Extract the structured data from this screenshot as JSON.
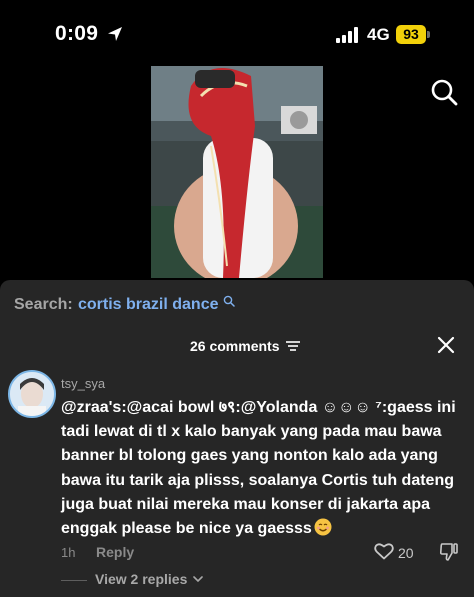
{
  "status_bar": {
    "time": "0:09",
    "network": "4G",
    "battery": "93"
  },
  "search": {
    "prefix": "Search:",
    "query": "cortis brazil dance"
  },
  "comments": {
    "count_label": "26 comments",
    "items": [
      {
        "username": "tsy_sya",
        "text": "@zraa's:@acai bowl ७९:@Yolanda ☺☺☺ ⁷:gaess ini tadi lewat di tl x kalo banyak yang pada mau bawa banner bl tolong gaes yang nonton kalo ada yang bawa itu tarik aja plisss, soalanya Cortis tuh dateng juga buat nilai mereka mau konser di jakarta apa enggak please be nice ya gaesss",
        "time": "1h",
        "reply_label": "Reply",
        "likes": "20",
        "view_replies_label": "View 2 replies"
      }
    ]
  },
  "colors": {
    "accent_link": "#7fb0ee",
    "sheet_bg": "#262626",
    "battery": "#f2d10a"
  }
}
